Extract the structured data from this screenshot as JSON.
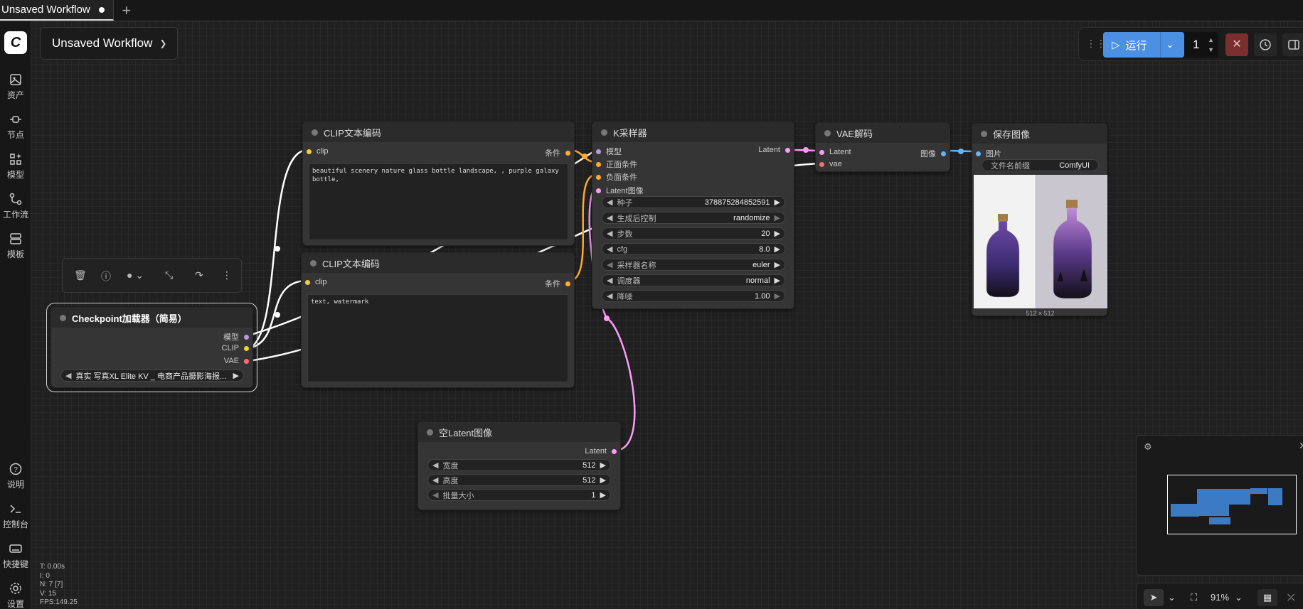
{
  "tab": {
    "title": "Unsaved Workflow",
    "add": "+"
  },
  "workflow": {
    "title": "Unsaved Workflow"
  },
  "run": {
    "label": "运行",
    "count": "1",
    "cancel": "✕"
  },
  "sidebar": {
    "items": [
      {
        "label": "资产",
        "icon": "image-icon"
      },
      {
        "label": "节点",
        "icon": "plug-icon"
      },
      {
        "label": "模型",
        "icon": "model-icon"
      },
      {
        "label": "工作流",
        "icon": "workflow-icon"
      },
      {
        "label": "模板",
        "icon": "template-icon"
      }
    ],
    "bottom_items": [
      {
        "label": "说明",
        "icon": "help-icon"
      },
      {
        "label": "控制台",
        "icon": "terminal-icon"
      },
      {
        "label": "快捷键",
        "icon": "keyboard-icon"
      },
      {
        "label": "设置",
        "icon": "gear-icon"
      }
    ]
  },
  "stats": {
    "t": "T: 0.00s",
    "i": "I: 0",
    "n": "N: 7 [7]",
    "v": "V: 15",
    "fps": "FPS:149.25"
  },
  "nodes": {
    "clip_pos": {
      "title": "CLIP文本编码",
      "in_clip": "clip",
      "out": "条件",
      "text": "beautiful scenery nature glass bottle landscape, , purple galaxy bottle,"
    },
    "clip_neg": {
      "title": "CLIP文本编码",
      "in_clip": "clip",
      "out": "条件",
      "text": "text, watermark"
    },
    "checkpoint": {
      "title": "Checkpoint加载器（简易）",
      "out_model": "模型",
      "out_clip": "CLIP",
      "out_vae": "VAE",
      "ckpt_name": "真实 写真XL Elite KV _ 电商产品摄影海报..."
    },
    "ksampler": {
      "title": "K采样器",
      "in_model": "模型",
      "in_pos": "正面条件",
      "in_neg": "负面条件",
      "in_latent": "Latent图像",
      "out": "Latent",
      "widgets": [
        {
          "label": "种子",
          "value": "378875284852591"
        },
        {
          "label": "生成后控制",
          "value": "randomize"
        },
        {
          "label": "步数",
          "value": "20"
        },
        {
          "label": "cfg",
          "value": "8.0"
        },
        {
          "label": "采样器名称",
          "value": "euler"
        },
        {
          "label": "调度器",
          "value": "normal"
        },
        {
          "label": "降噪",
          "value": "1.00"
        }
      ]
    },
    "vae": {
      "title": "VAE解码",
      "in_latent": "Latent",
      "in_vae": "vae",
      "out": "图像"
    },
    "save": {
      "title": "保存图像",
      "in_images": "图片",
      "prefix_label": "文件名前缀",
      "prefix_value": "ComfyUI",
      "size": "512 × 512"
    },
    "latent": {
      "title": "空Latent图像",
      "out": "Latent",
      "widgets": [
        {
          "label": "宽度",
          "value": "512"
        },
        {
          "label": "高度",
          "value": "512"
        },
        {
          "label": "批量大小",
          "value": "1"
        }
      ]
    }
  },
  "canvas": {
    "zoom": "91%"
  },
  "colors": {
    "model": "#b39ddb",
    "clip": "#f5d02c",
    "vae": "#ff6e6e",
    "conditioning": "#ffa931",
    "latent": "#ff9cf9",
    "image": "#64b5f6",
    "accent": "#4b90e2"
  }
}
